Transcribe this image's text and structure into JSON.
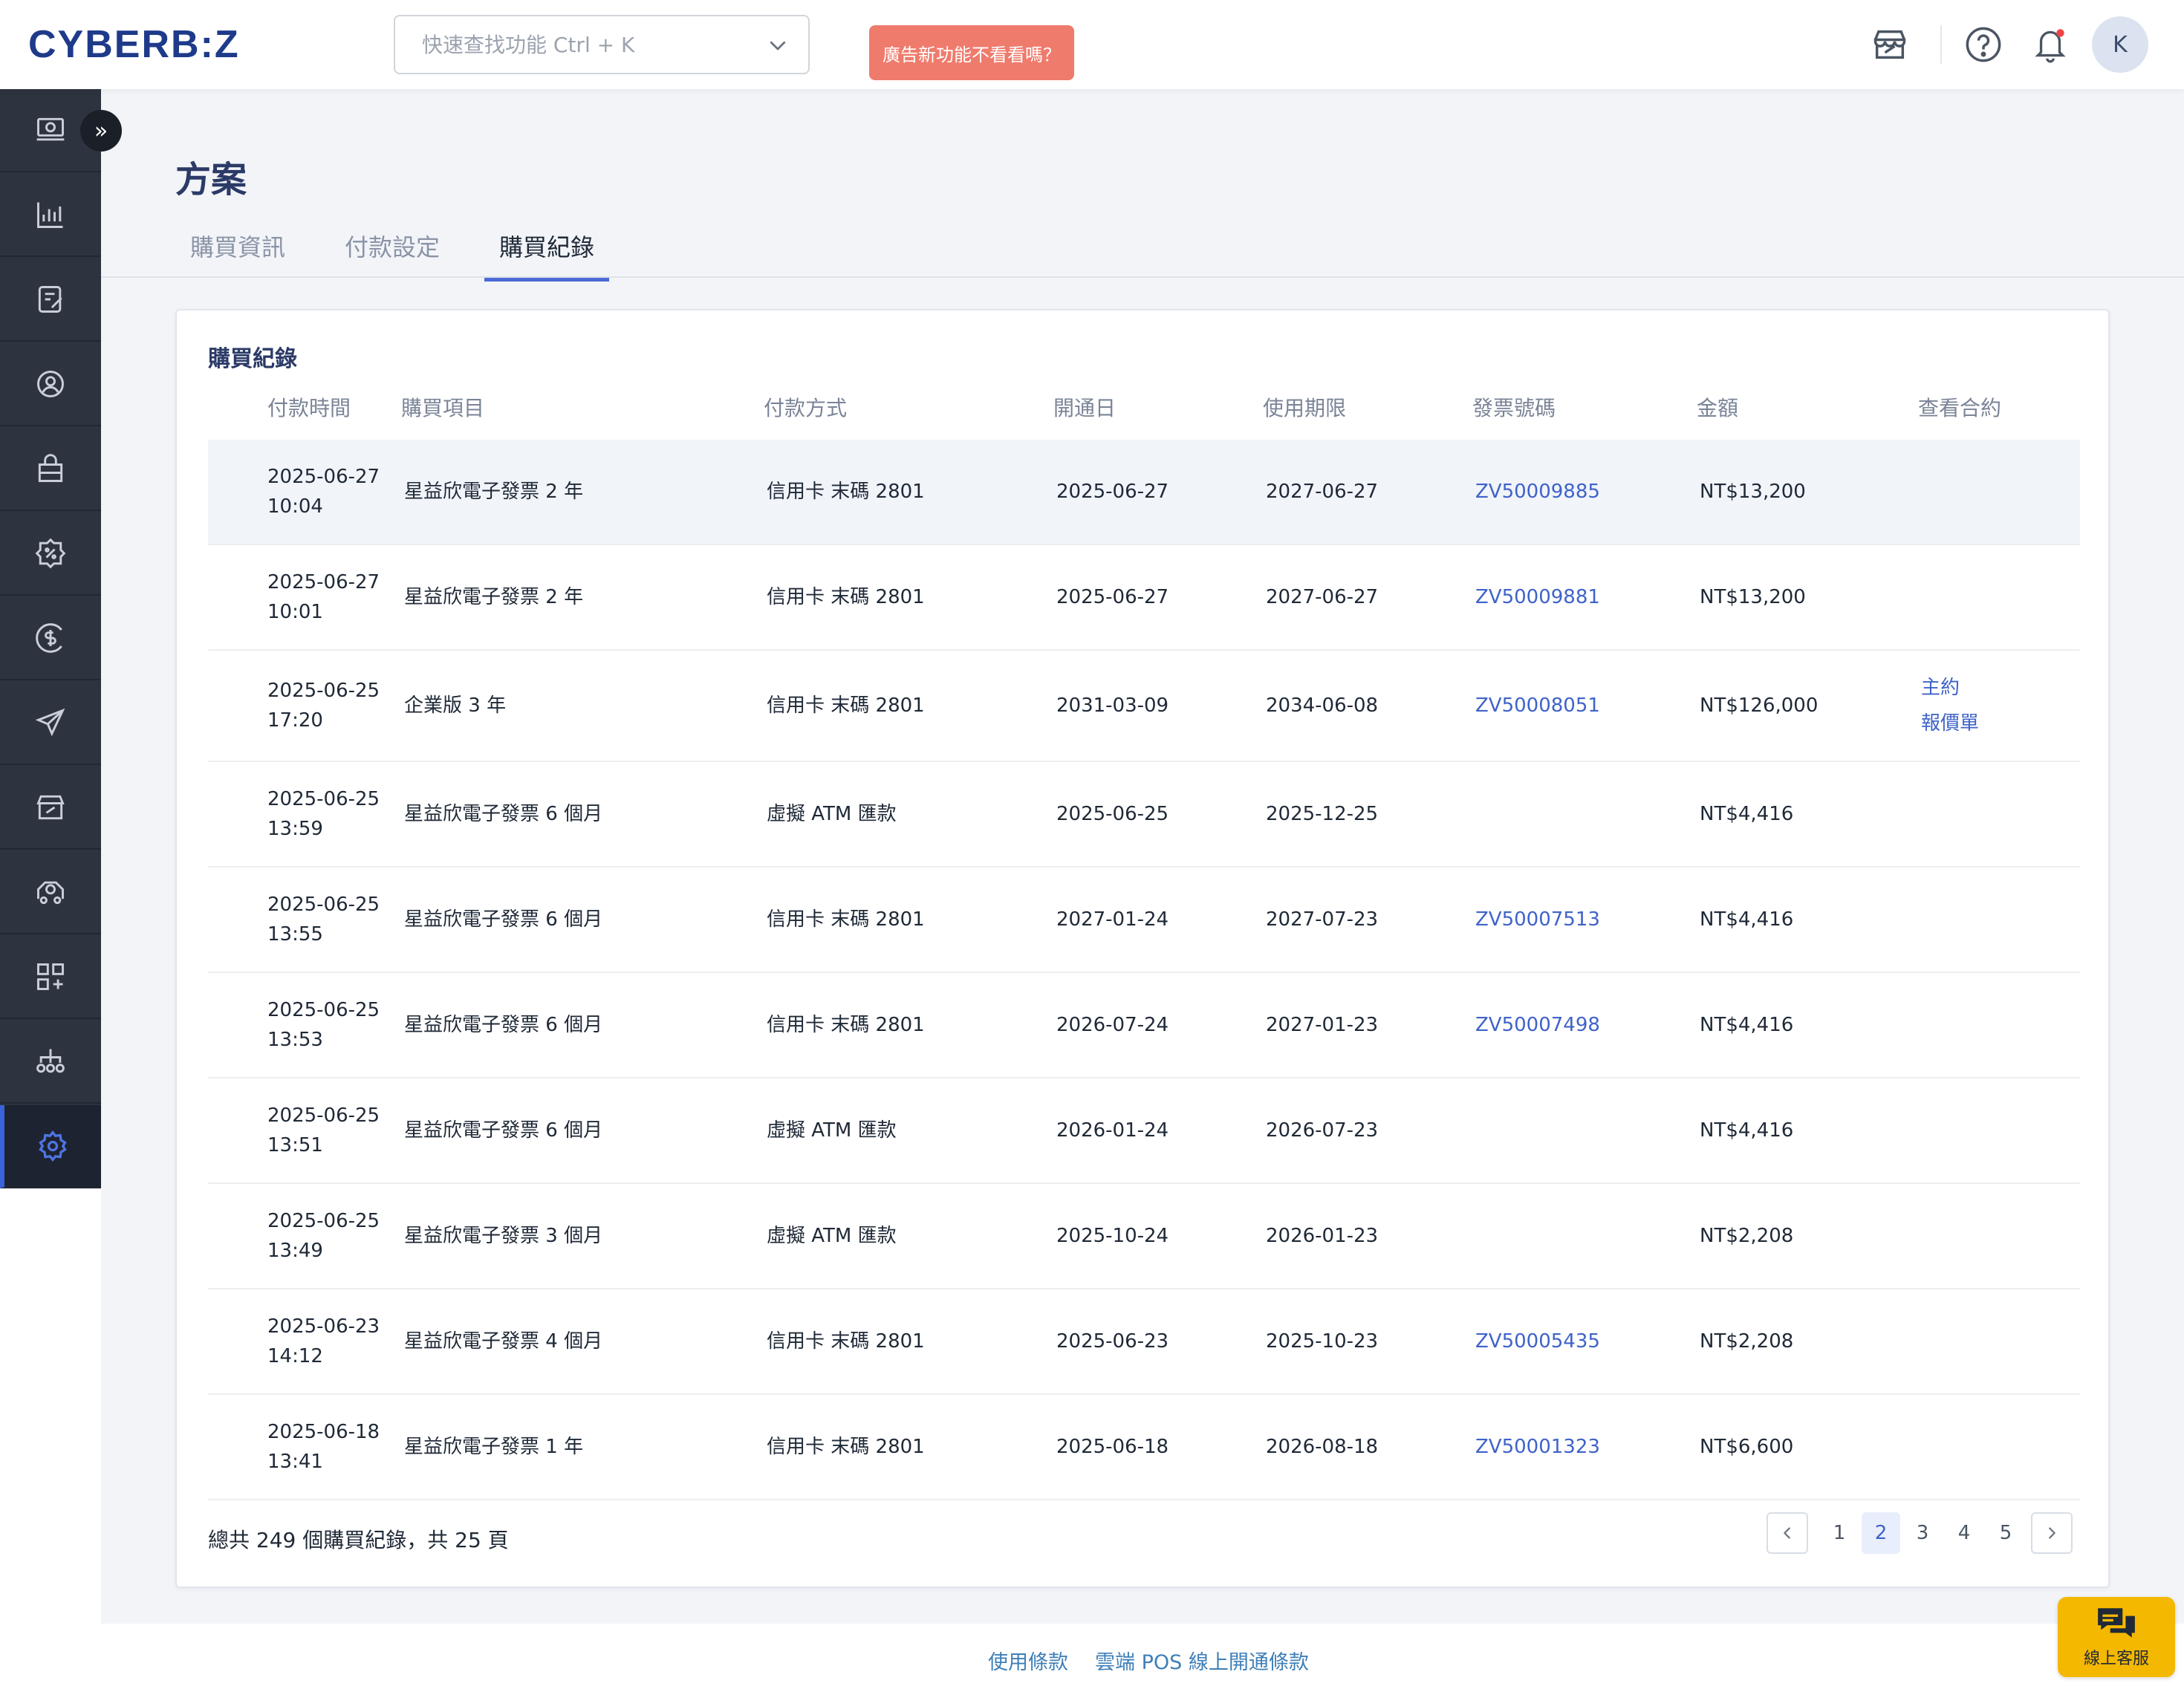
{
  "header": {
    "logo": "CYBERB:Z",
    "search_placeholder": "快速查找功能 Ctrl + K",
    "promo_label": "廣告新功能不看看嗎？",
    "avatar_initial": "K"
  },
  "sidebar": {
    "items": [
      "dashboard-icon",
      "analytics-icon",
      "orders-icon",
      "customers-icon",
      "products-icon",
      "promotions-icon",
      "finance-icon",
      "marketing-icon",
      "store-icon",
      "delivery-icon",
      "apps-icon",
      "channels-icon",
      "settings-icon"
    ],
    "active_index": 12
  },
  "page": {
    "title": "方案",
    "tabs": [
      "購買資訊",
      "付款設定",
      "購買紀錄"
    ],
    "active_tab": 2
  },
  "card": {
    "title": "購買紀錄",
    "columns": [
      "付款時間",
      "購買項目",
      "付款方式",
      "開通日",
      "使用期限",
      "發票號碼",
      "金額",
      "查看合約"
    ],
    "rows": [
      {
        "date": "2025-06-27",
        "time": "10:04",
        "item": "星益欣電子發票 2 年",
        "method": "信用卡 末碼 2801",
        "start": "2025-06-27",
        "end": "2027-06-27",
        "invoice": "ZV50009885",
        "amount": "NT$13,200",
        "contract": []
      },
      {
        "date": "2025-06-27",
        "time": "10:01",
        "item": "星益欣電子發票 2 年",
        "method": "信用卡 末碼 2801",
        "start": "2025-06-27",
        "end": "2027-06-27",
        "invoice": "ZV50009881",
        "amount": "NT$13,200",
        "contract": []
      },
      {
        "date": "2025-06-25",
        "time": "17:20",
        "item": "企業版 3 年",
        "method": "信用卡 末碼 2801",
        "start": "2031-03-09",
        "end": "2034-06-08",
        "invoice": "ZV50008051",
        "amount": "NT$126,000",
        "contract": [
          "主約",
          "報價單"
        ]
      },
      {
        "date": "2025-06-25",
        "time": "13:59",
        "item": "星益欣電子發票 6 個月",
        "method": "虛擬 ATM 匯款",
        "start": "2025-06-25",
        "end": "2025-12-25",
        "invoice": "",
        "amount": "NT$4,416",
        "contract": []
      },
      {
        "date": "2025-06-25",
        "time": "13:55",
        "item": "星益欣電子發票 6 個月",
        "method": "信用卡 末碼 2801",
        "start": "2027-01-24",
        "end": "2027-07-23",
        "invoice": "ZV50007513",
        "amount": "NT$4,416",
        "contract": []
      },
      {
        "date": "2025-06-25",
        "time": "13:53",
        "item": "星益欣電子發票 6 個月",
        "method": "信用卡 末碼 2801",
        "start": "2026-07-24",
        "end": "2027-01-23",
        "invoice": "ZV50007498",
        "amount": "NT$4,416",
        "contract": []
      },
      {
        "date": "2025-06-25",
        "time": "13:51",
        "item": "星益欣電子發票 6 個月",
        "method": "虛擬 ATM 匯款",
        "start": "2026-01-24",
        "end": "2026-07-23",
        "invoice": "",
        "amount": "NT$4,416",
        "contract": []
      },
      {
        "date": "2025-06-25",
        "time": "13:49",
        "item": "星益欣電子發票 3 個月",
        "method": "虛擬 ATM 匯款",
        "start": "2025-10-24",
        "end": "2026-01-23",
        "invoice": "",
        "amount": "NT$2,208",
        "contract": []
      },
      {
        "date": "2025-06-23",
        "time": "14:12",
        "item": "星益欣電子發票 4 個月",
        "method": "信用卡 末碼 2801",
        "start": "2025-06-23",
        "end": "2025-10-23",
        "invoice": "ZV50005435",
        "amount": "NT$2,208",
        "contract": []
      },
      {
        "date": "2025-06-18",
        "time": "13:41",
        "item": "星益欣電子發票 1 年",
        "method": "信用卡 末碼 2801",
        "start": "2025-06-18",
        "end": "2026-08-18",
        "invoice": "ZV50001323",
        "amount": "NT$6,600",
        "contract": []
      }
    ],
    "summary": "總共 249 個購買紀錄，共 25 頁",
    "pagination": {
      "pages": [
        "1",
        "2",
        "3",
        "4",
        "5"
      ],
      "active": "2"
    }
  },
  "footer": {
    "links": [
      "使用條款",
      "雲端 POS 線上開通條款"
    ]
  },
  "chat": {
    "label": "線上客服"
  },
  "colors": {
    "accent": "#3f63c9",
    "sidebar": "#2d3440",
    "promo": "#ef7b6c",
    "chat": "#f5b800"
  }
}
